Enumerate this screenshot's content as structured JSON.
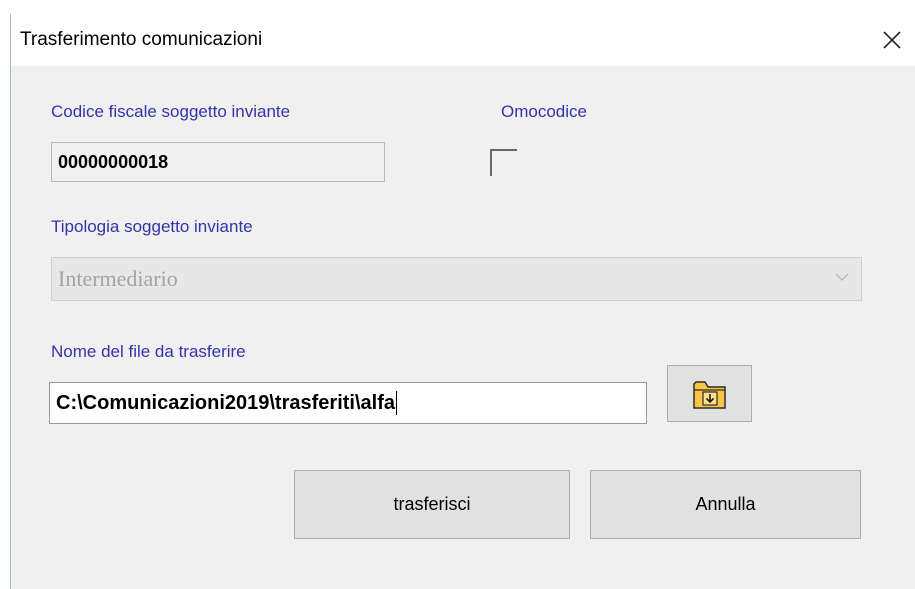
{
  "window": {
    "title": "Trasferimento comunicazioni",
    "close_icon": "close-icon"
  },
  "form": {
    "codice_fiscale_label": "Codice fiscale soggetto inviante",
    "codice_fiscale_value": "00000000018",
    "omocodice_label": "Omocodice",
    "omocodice_checked": false,
    "tipologia_label": "Tipologia soggetto inviante",
    "tipologia_value": "Intermediario",
    "file_label": "Nome del file da trasferire",
    "file_value": "C:\\Comunicazioni2019\\trasferiti\\alfa",
    "browse_icon": "folder-import-icon"
  },
  "buttons": {
    "transfer_label": "trasferisci",
    "cancel_label": "Annulla"
  },
  "colors": {
    "label": "#3333aa",
    "folder": "#f7c744"
  }
}
